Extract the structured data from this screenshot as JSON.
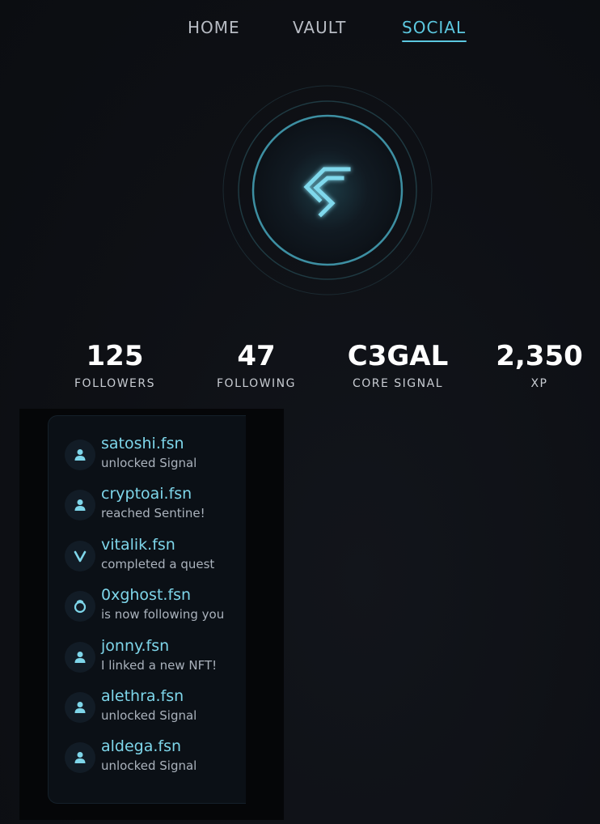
{
  "nav": {
    "tabs": [
      {
        "label": "HOME",
        "active": false
      },
      {
        "label": "VAULT",
        "active": false
      },
      {
        "label": "SOCIAL",
        "active": true
      }
    ]
  },
  "colors": {
    "accent": "#5cc8e0",
    "background": "#101217",
    "feed_name": "#7ed6ea",
    "feed_action": "#aab2bc"
  },
  "emblem": {
    "icon": "core-signal-logo-icon"
  },
  "stats": [
    {
      "value": "125",
      "label": "FOLLOWERS"
    },
    {
      "value": "47",
      "label": "FOLLOWING"
    },
    {
      "value": "C3GAL",
      "label": "CORE SIGNAL"
    },
    {
      "value": "2,350",
      "label": "XP"
    }
  ],
  "feed": {
    "items": [
      {
        "name": "satoshi.fsn",
        "action": "unlocked Signal",
        "icon": "user-icon"
      },
      {
        "name": "cryptoai.fsn",
        "action": "reached Sentine!",
        "icon": "user-icon"
      },
      {
        "name": "vitalik.fsn",
        "action": "completed a quest",
        "icon": "v-icon"
      },
      {
        "name": "0xghost.fsn",
        "action": "is now following you",
        "icon": "ghost-icon"
      },
      {
        "name": "jonny.fsn",
        "action": "I linked a new NFT!",
        "icon": "user-icon"
      },
      {
        "name": "alethra.fsn",
        "action": "unlocked Signal",
        "icon": "user-icon"
      },
      {
        "name": "aldega.fsn",
        "action": "unlocked Signal",
        "icon": "user-icon"
      }
    ]
  }
}
